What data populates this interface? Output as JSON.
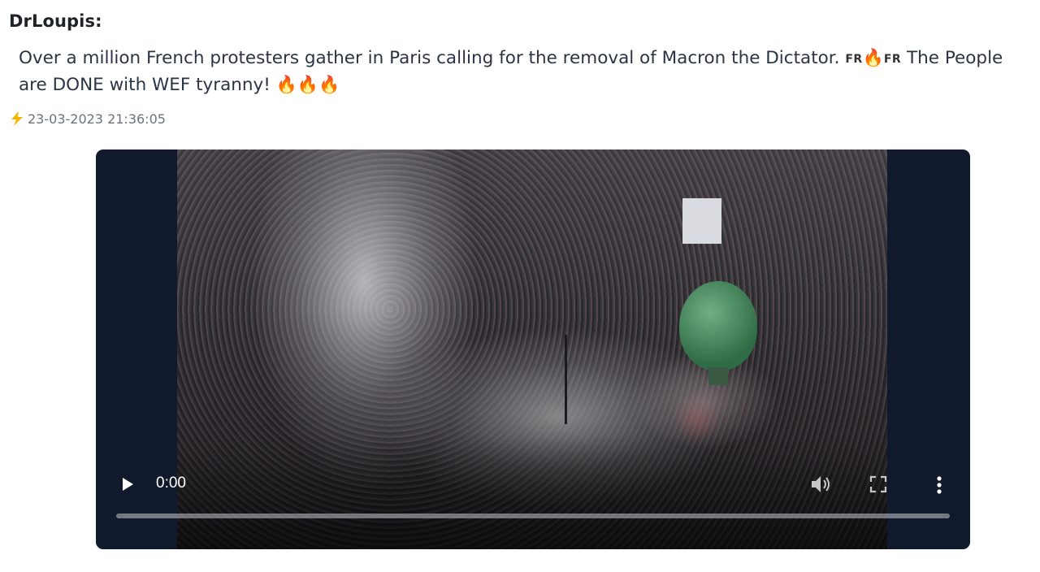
{
  "post": {
    "author": "DrLoupis:",
    "message_part1": "Over a million French protesters gather in Paris calling for the removal of Macron the Dictator.",
    "flag_label_1": "FR",
    "fire_emoji": "🔥",
    "flag_label_2": "FR",
    "message_part2": "The People are DONE with WEF tyranny!",
    "trailing_emojis": "🔥🔥🔥",
    "timestamp": "23-03-2023 21:36:05",
    "timestamp_icon": "lightning-bolt-icon"
  },
  "video": {
    "current_time": "0:00",
    "progress": 0,
    "icons": {
      "play": "play-icon",
      "volume": "volume-icon",
      "fullscreen": "fullscreen-icon",
      "more": "more-options-icon"
    },
    "colors": {
      "player_background": "#111a2c",
      "progress_track": "#c8c8cd",
      "progress_fill": "#ffffff"
    }
  }
}
